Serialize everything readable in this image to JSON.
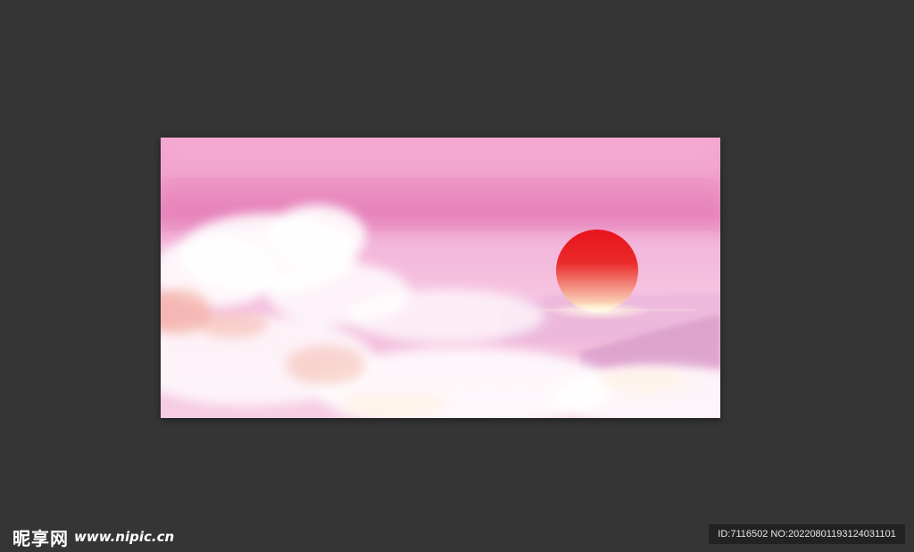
{
  "canvas": {
    "background_color": "#353535"
  },
  "artwork": {
    "scene": "pink sky with clouds and red sun",
    "colors": {
      "sky_top": "#f3a6cf",
      "sky_band": "#e889bd",
      "sky_mid": "#f6c3e0",
      "sun_top": "#e8141a",
      "sun_bottom": "#fff2c8",
      "cloud": "#ffffff"
    }
  },
  "watermark": {
    "site_name": "昵享网",
    "url": "www.nipic.cn",
    "image_info": "ID:7116502 NO:20220801193124031101"
  }
}
